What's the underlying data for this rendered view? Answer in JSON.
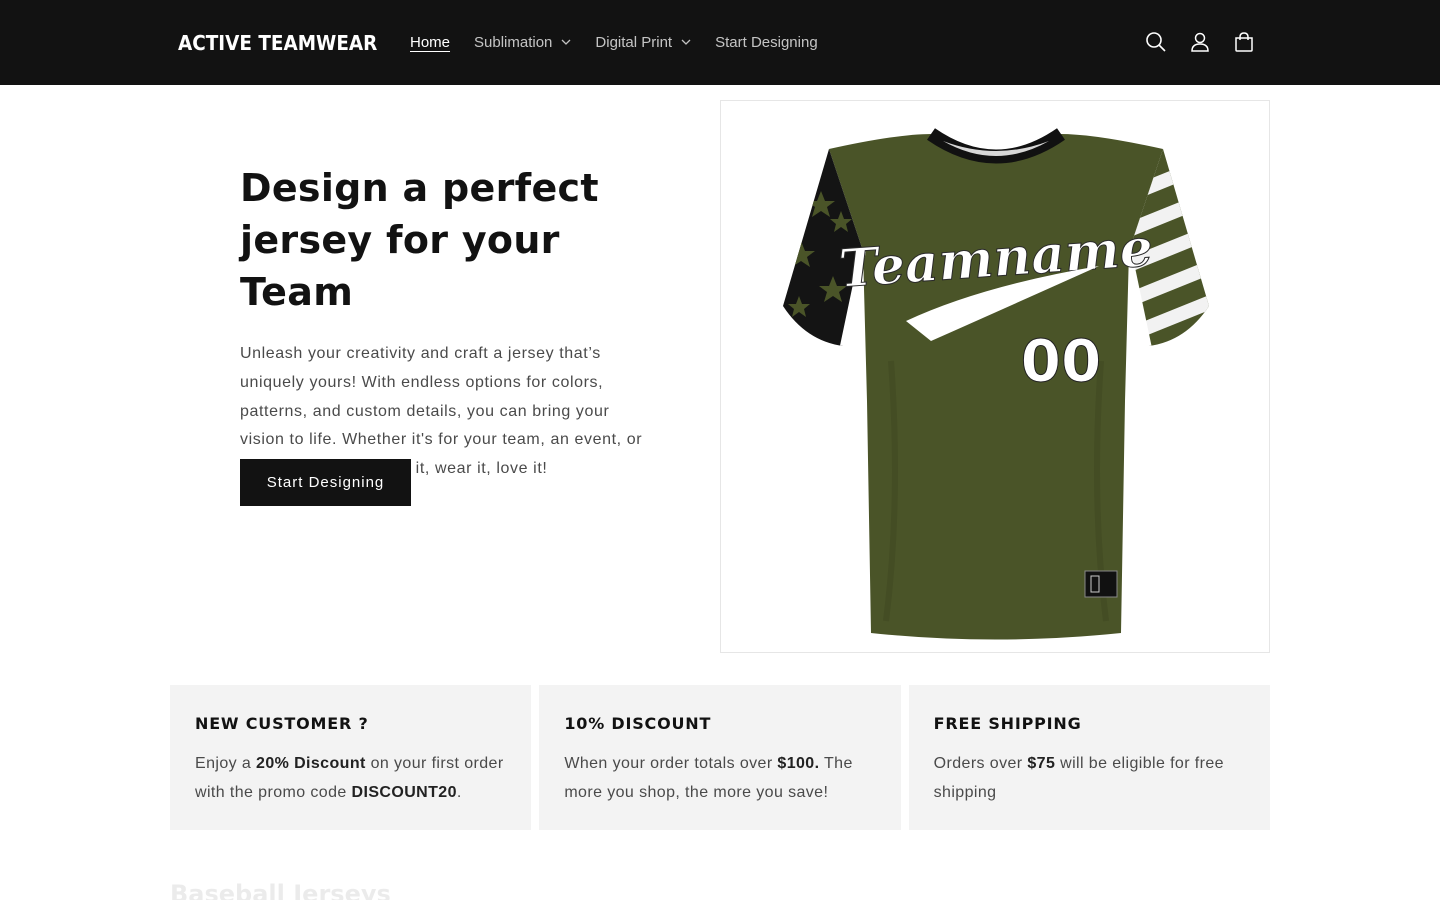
{
  "header": {
    "logo": "ACTIVE TEAMWEAR",
    "nav": [
      {
        "label": "Home",
        "active": true,
        "dropdown": false
      },
      {
        "label": "Sublimation",
        "active": false,
        "dropdown": true
      },
      {
        "label": "Digital Print",
        "active": false,
        "dropdown": true
      },
      {
        "label": "Start Designing",
        "active": false,
        "dropdown": false
      }
    ],
    "icons": [
      "search-icon",
      "account-icon",
      "cart-icon"
    ]
  },
  "hero": {
    "title": "Design a perfect jersey for your Team",
    "description": "Unleash your creativity and craft a jersey that’s uniquely yours! With endless options for colors, patterns, and custom details, you can bring your vision to life. Whether it's for your team, an event, or personal style. Design it, wear it, love it!",
    "button": "Start Designing",
    "jersey": {
      "team_text": "Teamname",
      "number": "00",
      "body_color": "#4a5428",
      "accent_color": "#ffffff",
      "collar_color": "#111111"
    }
  },
  "cards": [
    {
      "title": "NEW CUSTOMER ?",
      "text_parts": [
        "Enjoy a ",
        "20% Discount",
        " on your first order with the promo code ",
        "DISCOUNT20",
        "."
      ]
    },
    {
      "title": "10% DISCOUNT",
      "text_parts": [
        "When your order totals over ",
        "$100.",
        " The more you shop, the more you save!"
      ]
    },
    {
      "title": "FREE SHIPPING",
      "text_parts": [
        "Orders over ",
        "$75",
        " will be eligible for free shipping"
      ]
    }
  ],
  "next_section_heading": "Baseball Jerseys"
}
